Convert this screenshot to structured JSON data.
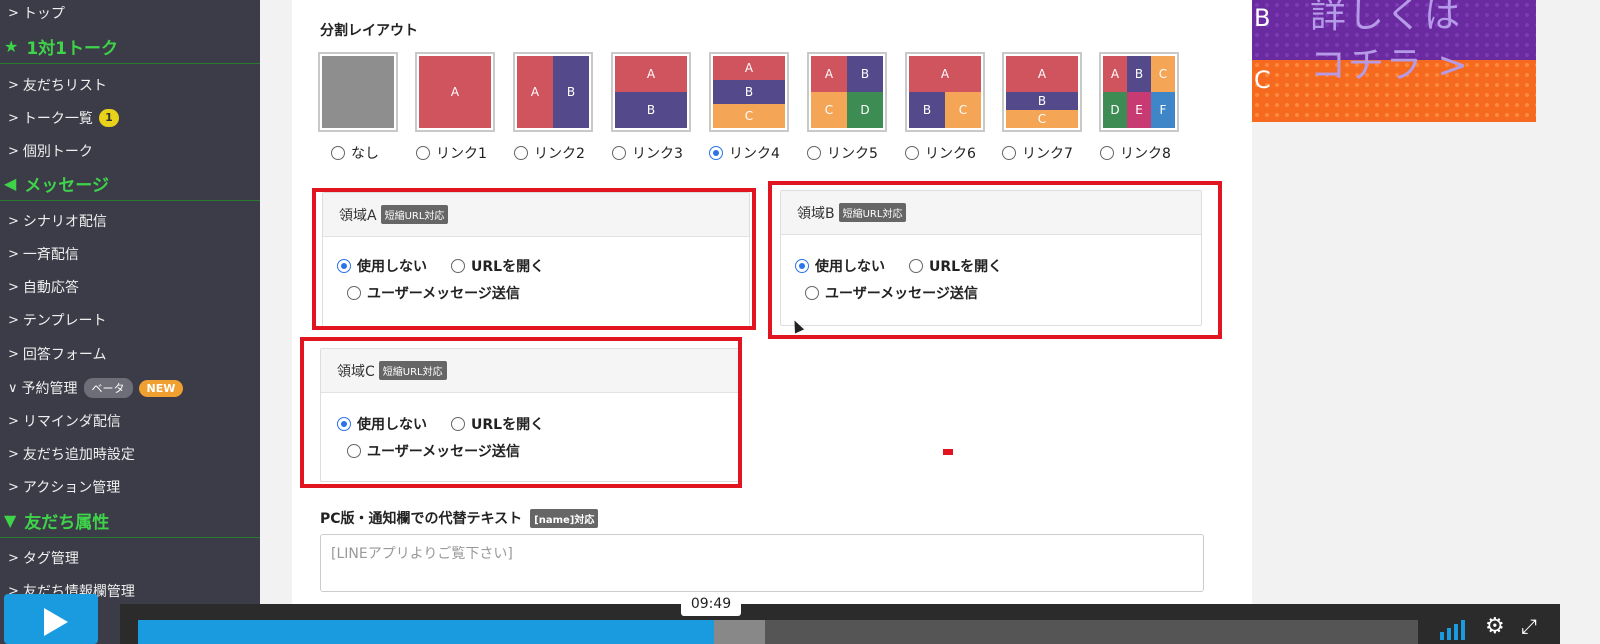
{
  "sidebar": {
    "items": [
      {
        "type": "item",
        "label": "トップ"
      },
      {
        "type": "section",
        "label": "1対1トーク",
        "icon": "star-icon"
      },
      {
        "type": "item",
        "label": "友だちリスト"
      },
      {
        "type": "item",
        "label": "トーク一覧",
        "badge": "1"
      },
      {
        "type": "item",
        "label": "個別トーク"
      },
      {
        "type": "section",
        "label": "メッセージ",
        "icon": "megaphone-icon"
      },
      {
        "type": "item",
        "label": "シナリオ配信"
      },
      {
        "type": "item",
        "label": "一斉配信"
      },
      {
        "type": "item",
        "label": "自動応答"
      },
      {
        "type": "item",
        "label": "テンプレート"
      },
      {
        "type": "item",
        "label": "回答フォーム"
      },
      {
        "type": "item",
        "label": "予約管理",
        "badge_beta": "ベータ",
        "badge_new": "NEW",
        "expanded": true
      },
      {
        "type": "item",
        "label": "リマインダ配信"
      },
      {
        "type": "item",
        "label": "友だち追加時設定"
      },
      {
        "type": "item",
        "label": "アクション管理"
      },
      {
        "type": "section",
        "label": "友だち属性",
        "icon": "filter-icon"
      },
      {
        "type": "item",
        "label": "タグ管理"
      },
      {
        "type": "item",
        "label": "友だち情報欄管理"
      }
    ]
  },
  "layout_section": {
    "title": "分割レイアウト",
    "options": [
      {
        "label": "なし",
        "selected": false
      },
      {
        "label": "リンク1",
        "selected": false
      },
      {
        "label": "リンク2",
        "selected": false
      },
      {
        "label": "リンク3",
        "selected": false
      },
      {
        "label": "リンク4",
        "selected": true
      },
      {
        "label": "リンク5",
        "selected": false
      },
      {
        "label": "リンク6",
        "selected": false
      },
      {
        "label": "リンク7",
        "selected": false
      },
      {
        "label": "リンク8",
        "selected": false
      }
    ],
    "cell_letters": [
      "A",
      "B",
      "C",
      "D",
      "E",
      "F"
    ]
  },
  "regions": [
    {
      "title": "領域A",
      "tag": "短縮URL対応",
      "opt_none": "使用しない",
      "opt_url": "URLを開く",
      "opt_msg": "ユーザーメッセージ送信"
    },
    {
      "title": "領域B",
      "tag": "短縮URL対応",
      "opt_none": "使用しない",
      "opt_url": "URLを開く",
      "opt_msg": "ユーザーメッセージ送信"
    },
    {
      "title": "領域C",
      "tag": "短縮URL対応",
      "opt_none": "使用しない",
      "opt_url": "URLを開く",
      "opt_msg": "ユーザーメッセージ送信"
    }
  ],
  "alt_text": {
    "title": "PC版・通知欄での代替テキスト",
    "tag": "[name]対応",
    "placeholder": "[LINEアプリよりご覧下さい]"
  },
  "promo": {
    "line1": "詳しくは",
    "line2": "コチラ >",
    "letter_b": "B",
    "letter_c": "C"
  },
  "player": {
    "time": "09:49",
    "progress": 0.45,
    "buffered": 0.49
  },
  "colors": {
    "sidebar_bg": "#3b3c47",
    "section_green": "#3fd34a",
    "cell_red": "#cf545e",
    "cell_purple": "#54498a",
    "cell_orange": "#f4a556",
    "cell_green": "#3d8c54",
    "cell_pink": "#c83a72",
    "cell_blue": "#3e86c8",
    "highlight_red": "#e0151f",
    "player_blue": "#1a9be0"
  }
}
